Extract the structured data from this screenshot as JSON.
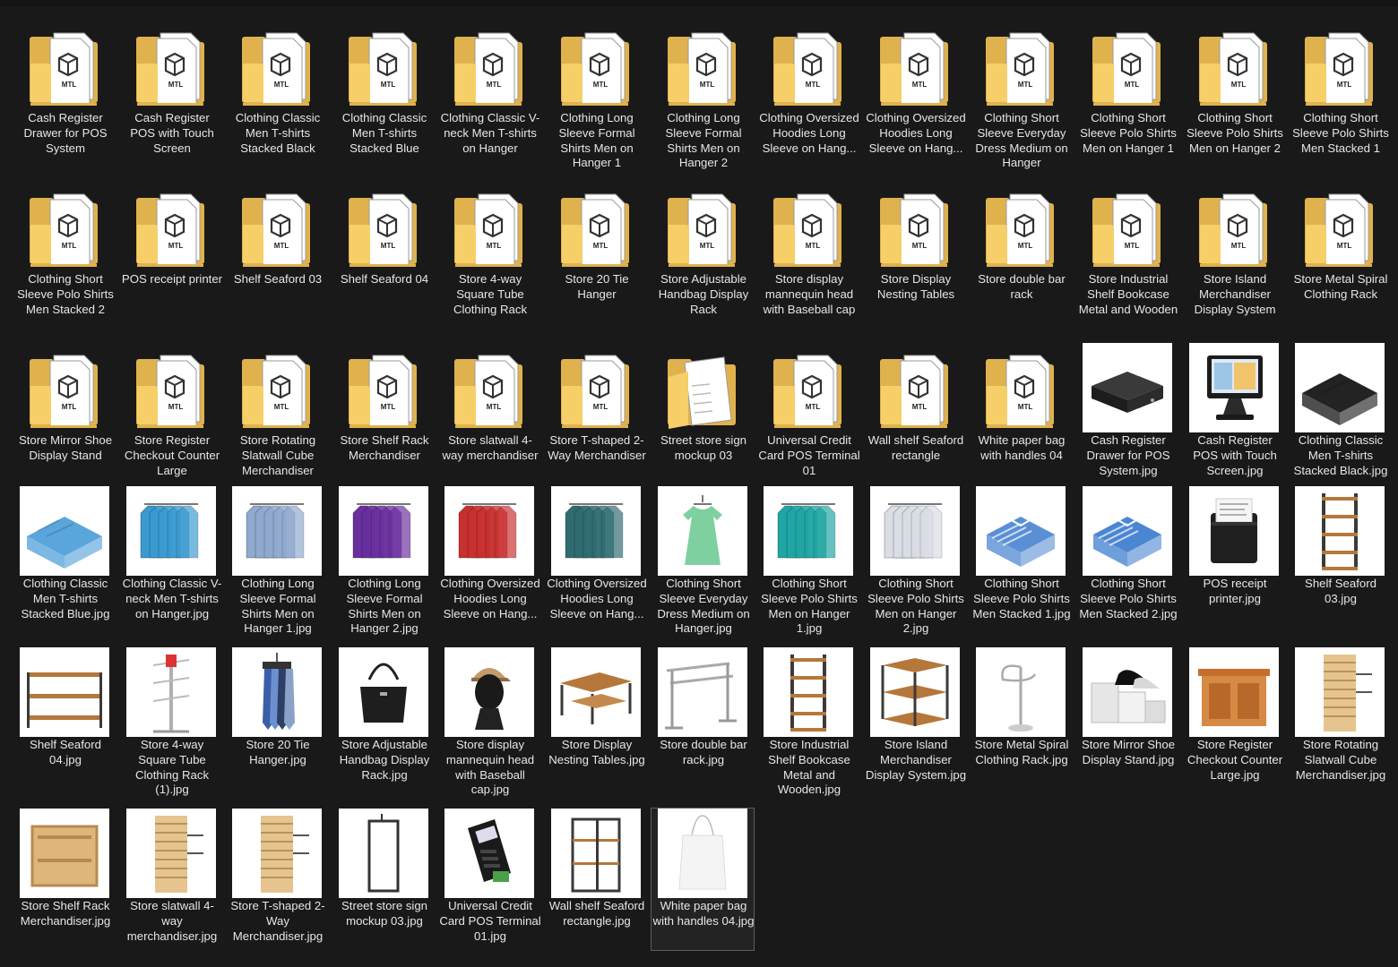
{
  "explorer": {
    "colors": {
      "background": "#191919",
      "text": "#e6e6e6",
      "folder_back": "#e0b24d",
      "folder_front": "#f7cf68",
      "selection_border": "#5e5e5e"
    },
    "items": [
      {
        "label": "Cash Register Drawer for POS System",
        "kind": "folder",
        "icon": "folder-icon"
      },
      {
        "label": "Cash Register POS with Touch Screen",
        "kind": "folder",
        "icon": "folder-icon"
      },
      {
        "label": "Clothing Classic Men T-shirts Stacked Black",
        "kind": "folder",
        "icon": "folder-icon"
      },
      {
        "label": "Clothing Classic Men T-shirts Stacked Blue",
        "kind": "folder",
        "icon": "folder-icon"
      },
      {
        "label": "Clothing Classic V-neck Men T-shirts on Hanger",
        "kind": "folder",
        "icon": "folder-icon"
      },
      {
        "label": "Clothing Long Sleeve Formal Shirts Men on Hanger 1",
        "kind": "folder",
        "icon": "folder-icon"
      },
      {
        "label": "Clothing Long Sleeve Formal Shirts Men on Hanger 2",
        "kind": "folder",
        "icon": "folder-icon"
      },
      {
        "label": "Clothing Oversized Hoodies Long Sleeve on Hang...",
        "kind": "folder",
        "icon": "folder-icon"
      },
      {
        "label": "Clothing Oversized Hoodies Long Sleeve on Hang...",
        "kind": "folder",
        "icon": "folder-icon"
      },
      {
        "label": "Clothing Short Sleeve Everyday Dress Medium on Hanger",
        "kind": "folder",
        "icon": "folder-icon"
      },
      {
        "label": "Clothing Short Sleeve Polo Shirts Men on Hanger 1",
        "kind": "folder",
        "icon": "folder-icon"
      },
      {
        "label": "Clothing Short Sleeve Polo Shirts Men on Hanger 2",
        "kind": "folder",
        "icon": "folder-icon"
      },
      {
        "label": "Clothing Short Sleeve Polo Shirts Men Stacked 1",
        "kind": "folder",
        "icon": "folder-icon"
      },
      {
        "label": "Clothing Short Sleeve Polo Shirts Men Stacked 2",
        "kind": "folder",
        "icon": "folder-icon"
      },
      {
        "label": "POS receipt printer",
        "kind": "folder",
        "icon": "folder-icon"
      },
      {
        "label": "Shelf Seaford 03",
        "kind": "folder",
        "icon": "folder-icon"
      },
      {
        "label": "Shelf Seaford 04",
        "kind": "folder",
        "icon": "folder-icon"
      },
      {
        "label": "Store 4-way Square Tube Clothing Rack",
        "kind": "folder",
        "icon": "folder-icon"
      },
      {
        "label": "Store 20 Tie Hanger",
        "kind": "folder",
        "icon": "folder-icon"
      },
      {
        "label": "Store Adjustable Handbag Display Rack",
        "kind": "folder",
        "icon": "folder-icon"
      },
      {
        "label": "Store display mannequin head with Baseball cap",
        "kind": "folder",
        "icon": "folder-icon"
      },
      {
        "label": "Store Display Nesting Tables",
        "kind": "folder",
        "icon": "folder-icon"
      },
      {
        "label": "Store double bar rack",
        "kind": "folder",
        "icon": "folder-icon"
      },
      {
        "label": "Store Industrial Shelf Bookcase Metal and Wooden",
        "kind": "folder",
        "icon": "folder-icon"
      },
      {
        "label": "Store Island Merchandiser Display System",
        "kind": "folder",
        "icon": "folder-icon"
      },
      {
        "label": "Store Metal Spiral Clothing Rack",
        "kind": "folder",
        "icon": "folder-icon"
      },
      {
        "label": "Store Mirror Shoe Display Stand",
        "kind": "folder",
        "icon": "folder-icon"
      },
      {
        "label": "Store Register Checkout Counter Large",
        "kind": "folder",
        "icon": "folder-icon"
      },
      {
        "label": "Store Rotating Slatwall Cube Merchandiser",
        "kind": "folder",
        "icon": "folder-icon"
      },
      {
        "label": "Store Shelf Rack Merchandiser",
        "kind": "folder",
        "icon": "folder-icon"
      },
      {
        "label": "Store slatwall 4-way merchandiser",
        "kind": "folder",
        "icon": "folder-icon"
      },
      {
        "label": "Store T-shaped 2-Way Merchandiser",
        "kind": "folder",
        "icon": "folder-icon"
      },
      {
        "label": "Street store sign mockup 03",
        "kind": "folder-open",
        "icon": "folder-open-icon"
      },
      {
        "label": "Universal Credit Card POS Terminal 01",
        "kind": "folder",
        "icon": "folder-icon"
      },
      {
        "label": "Wall shelf Seaford rectangle",
        "kind": "folder",
        "icon": "folder-icon"
      },
      {
        "label": "White paper bag with handles 04",
        "kind": "folder",
        "icon": "folder-icon"
      },
      {
        "label": "Cash Register Drawer for POS System.jpg",
        "kind": "image",
        "icon": "cash-drawer-icon"
      },
      {
        "label": "Cash Register POS with Touch Screen.jpg",
        "kind": "image",
        "icon": "pos-terminal-icon"
      },
      {
        "label": "Clothing Classic Men T-shirts Stacked Black.jpg",
        "kind": "image",
        "icon": "tshirt-stack-icon",
        "color": "#232323"
      },
      {
        "label": "Clothing Classic Men T-shirts Stacked Blue.jpg",
        "kind": "image",
        "icon": "tshirt-stack-icon",
        "color": "#5aa6dc"
      },
      {
        "label": "Clothing Classic V-neck Men T-shirts on Hanger.jpg",
        "kind": "image",
        "icon": "hanger-shirts-icon",
        "color": "#3a9ad0"
      },
      {
        "label": "Clothing Long Sleeve Formal Shirts Men on Hanger 1.jpg",
        "kind": "image",
        "icon": "hanger-shirts-icon",
        "color": "#8fa9cf"
      },
      {
        "label": "Clothing Long Sleeve Formal Shirts Men on Hanger 2.jpg",
        "kind": "image",
        "icon": "hanger-shirts-icon",
        "color": "#6a2f9e"
      },
      {
        "label": "Clothing Oversized Hoodies Long Sleeve on Hang...",
        "kind": "image",
        "icon": "hanger-shirts-icon",
        "color": "#c8302f"
      },
      {
        "label": "Clothing Oversized Hoodies Long Sleeve on Hang...",
        "kind": "image",
        "icon": "hanger-shirts-icon",
        "color": "#2f6c72"
      },
      {
        "label": "Clothing Short Sleeve Everyday Dress Medium on Hanger.jpg",
        "kind": "image",
        "icon": "dress-icon",
        "color": "#7fd0a0"
      },
      {
        "label": "Clothing Short Sleeve Polo Shirts Men on Hanger 1.jpg",
        "kind": "image",
        "icon": "hanger-shirts-icon",
        "color": "#1fa6a4"
      },
      {
        "label": "Clothing Short Sleeve Polo Shirts Men on Hanger 2.jpg",
        "kind": "image",
        "icon": "hanger-shirts-icon",
        "color": "#d9dde4"
      },
      {
        "label": "Clothing Short Sleeve Polo Shirts Men Stacked 1.jpg",
        "kind": "image",
        "icon": "shirt-stack-icon",
        "color": "#5a8fd6"
      },
      {
        "label": "Clothing Short Sleeve Polo Shirts Men Stacked 2.jpg",
        "kind": "image",
        "icon": "shirt-stack-icon",
        "color": "#4a86d2"
      },
      {
        "label": "POS receipt printer.jpg",
        "kind": "image",
        "icon": "receipt-printer-icon"
      },
      {
        "label": "Shelf Seaford 03.jpg",
        "kind": "image",
        "icon": "tall-shelf-icon"
      },
      {
        "label": "Shelf Seaford 04.jpg",
        "kind": "image",
        "icon": "low-shelf-icon"
      },
      {
        "label": "Store 4-way Square Tube Clothing Rack (1).jpg",
        "kind": "image",
        "icon": "rack-icon"
      },
      {
        "label": "Store 20 Tie Hanger.jpg",
        "kind": "image",
        "icon": "tie-hanger-icon"
      },
      {
        "label": "Store Adjustable Handbag Display Rack.jpg",
        "kind": "image",
        "icon": "handbag-icon"
      },
      {
        "label": "Store display mannequin head with Baseball cap.jpg",
        "kind": "image",
        "icon": "mannequin-head-icon"
      },
      {
        "label": "Store Display Nesting Tables.jpg",
        "kind": "image",
        "icon": "nesting-tables-icon"
      },
      {
        "label": "Store double bar rack.jpg",
        "kind": "image",
        "icon": "double-bar-rack-icon"
      },
      {
        "label": "Store Industrial Shelf Bookcase Metal and Wooden.jpg",
        "kind": "image",
        "icon": "tall-shelf-icon"
      },
      {
        "label": "Store Island Merchandiser Display System.jpg",
        "kind": "image",
        "icon": "island-display-icon"
      },
      {
        "label": "Store Metal Spiral Clothing Rack.jpg",
        "kind": "image",
        "icon": "spiral-rack-icon"
      },
      {
        "label": "Store Mirror Shoe Display Stand.jpg",
        "kind": "image",
        "icon": "shoe-stand-icon"
      },
      {
        "label": "Store Register Checkout Counter Large.jpg",
        "kind": "image",
        "icon": "checkout-counter-icon"
      },
      {
        "label": "Store Rotating Slatwall Cube Merchandiser.jpg",
        "kind": "image",
        "icon": "slatwall-tower-icon"
      },
      {
        "label": "Store Shelf Rack Merchandiser.jpg",
        "kind": "image",
        "icon": "wood-cabinet-icon"
      },
      {
        "label": "Store slatwall 4-way merchandiser.jpg",
        "kind": "image",
        "icon": "slatwall-tower-icon"
      },
      {
        "label": "Store T-shaped 2-Way Merchandiser.jpg",
        "kind": "image",
        "icon": "slatwall-tower-icon"
      },
      {
        "label": "Street store sign mockup 03.jpg",
        "kind": "image",
        "icon": "sign-icon"
      },
      {
        "label": "Universal Credit Card POS Terminal 01.jpg",
        "kind": "image",
        "icon": "card-terminal-icon"
      },
      {
        "label": "Wall shelf Seaford rectangle.jpg",
        "kind": "image",
        "icon": "wall-shelf-icon"
      },
      {
        "label": "White paper bag with handles 04.jpg",
        "kind": "image",
        "icon": "paper-bag-icon",
        "selected": true
      }
    ]
  }
}
